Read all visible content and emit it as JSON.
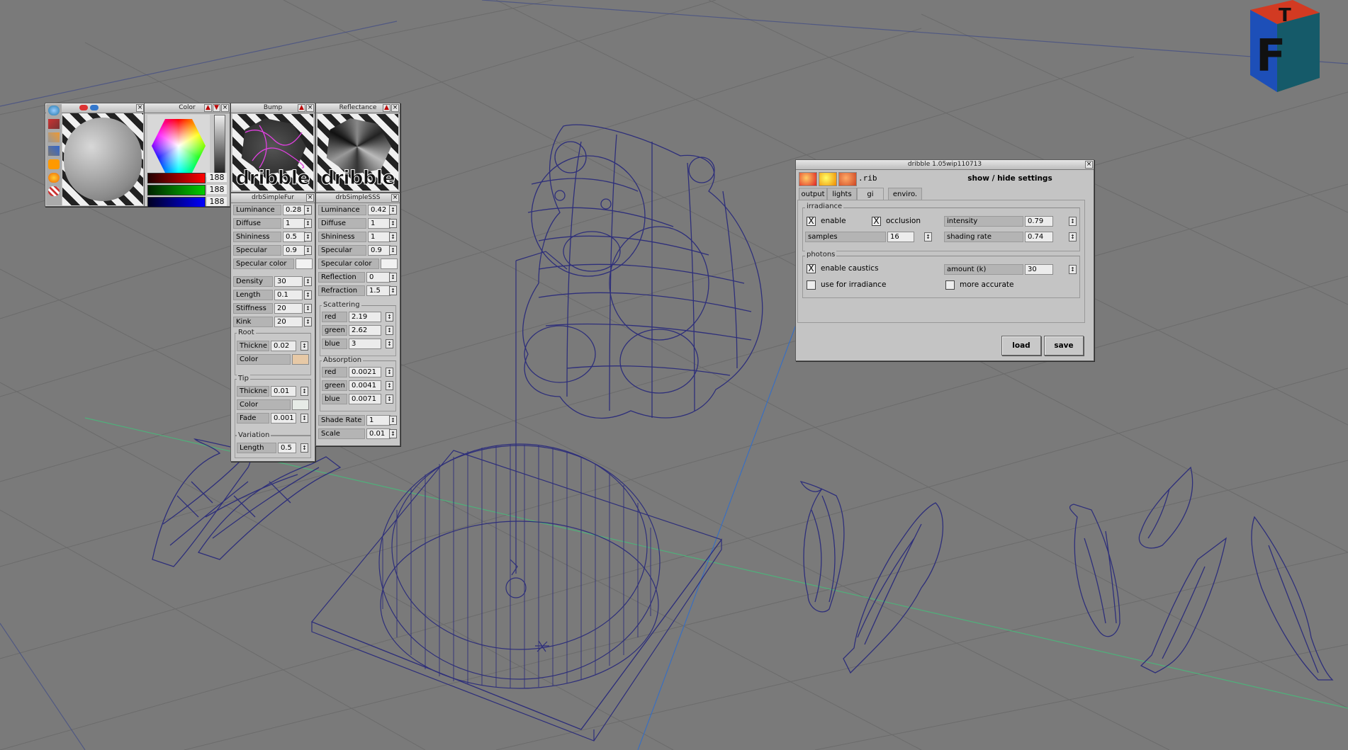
{
  "surface_preview": {
    "color_panel_title": "Color",
    "rgb": [
      "188",
      "188",
      "188"
    ]
  },
  "bump_panel": {
    "title": "Bump",
    "logo_text": "dribble"
  },
  "reflectance_panel": {
    "title": "Reflectance",
    "logo_text": "dribble"
  },
  "fur_panel": {
    "title": "drbSimpleFur",
    "rows": [
      {
        "label": "Luminance",
        "value": "0.28"
      },
      {
        "label": "Diffuse",
        "value": "1"
      },
      {
        "label": "Shininess",
        "value": "0.5"
      },
      {
        "label": "Specular",
        "value": "0.9"
      }
    ],
    "specular_color_label": "Specular color",
    "rows2": [
      {
        "label": "Density",
        "value": "30"
      },
      {
        "label": "Length",
        "value": "0.1"
      },
      {
        "label": "Stiffness",
        "value": "20"
      },
      {
        "label": "Kink",
        "value": "20"
      }
    ],
    "root_label": "Root",
    "root_thickness_label": "Thickne",
    "root_thickness_value": "0.02",
    "root_color_label": "Color",
    "tip_label": "Tip",
    "tip_thickness_label": "Thickne",
    "tip_thickness_value": "0.01",
    "tip_color_label": "Color",
    "tip_fade_label": "Fade",
    "tip_fade_value": "0.001",
    "variation_label": "Variation",
    "variation_length_label": "Length",
    "variation_length_value": "0.5"
  },
  "sss_panel": {
    "title": "drbSimpleSSS",
    "rows": [
      {
        "label": "Luminance",
        "value": "0.42"
      },
      {
        "label": "Diffuse",
        "value": "1"
      },
      {
        "label": "Shininess",
        "value": "1"
      },
      {
        "label": "Specular",
        "value": "0.9"
      }
    ],
    "specular_color_label": "Specular color",
    "reflection_label": "Reflection",
    "reflection_value": "0",
    "refraction_label": "Refraction",
    "refraction_value": "1.5",
    "scattering_label": "Scattering",
    "scattering": [
      {
        "label": "red",
        "value": "2.19"
      },
      {
        "label": "green",
        "value": "2.62"
      },
      {
        "label": "blue",
        "value": "3"
      }
    ],
    "absorption_label": "Absorption",
    "absorption": [
      {
        "label": "red",
        "value": "0.0021"
      },
      {
        "label": "green",
        "value": "0.0041"
      },
      {
        "label": "blue",
        "value": "0.0071"
      }
    ],
    "shade_rate_label": "Shade Rate",
    "shade_rate_value": "1",
    "scale_label": "Scale",
    "scale_value": "0.01"
  },
  "dribble_dialog": {
    "title": "dribble 1.05wip110713",
    "rib_label": ".rib",
    "toggle_label": "show / hide settings",
    "tabs": [
      "output",
      "lights",
      "gi",
      "enviro."
    ],
    "active_tab": "gi",
    "irradiance_label": "irradiance",
    "enable_label": "enable",
    "occlusion_label": "occlusion",
    "intensity_label": "intensity",
    "intensity_value": "0.79",
    "samples_label": "samples",
    "samples_value": "16",
    "shading_rate_label": "shading rate",
    "shading_rate_value": "0.74",
    "photons_label": "photons",
    "enable_caustics_label": "enable caustics",
    "amount_label": "amount (k)",
    "amount_value": "30",
    "use_for_irradiance_label": "use for irradiance",
    "more_accurate_label": "more accurate",
    "load_label": "load",
    "save_label": "save",
    "checked_mark": "X"
  },
  "view_cube": {
    "front_letter": "F",
    "top_letter": "T"
  },
  "colors": {
    "viewport_bg": "#7a7a7a",
    "grid": "#6b6b6b",
    "wire": "#2e2f7a",
    "axis_green": "#4fb07a",
    "axis_blue": "#3a6fc0"
  }
}
